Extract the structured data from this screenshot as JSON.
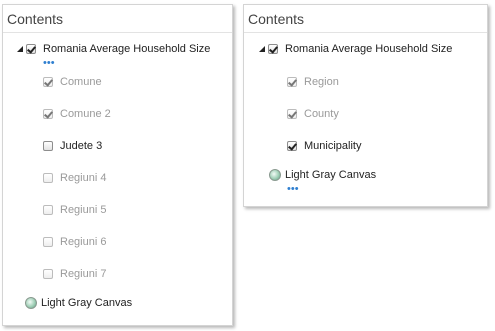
{
  "panels": [
    {
      "title": "Contents",
      "layer": {
        "label": "Romania Average Household Size",
        "checked": true,
        "more": "•••"
      },
      "sublayers": [
        {
          "label": "Comune",
          "checked": true
        },
        {
          "label": "Comune 2",
          "checked": true
        },
        {
          "label": "Judete 3",
          "checked": false
        },
        {
          "label": "Regiuni 4",
          "checked": false
        },
        {
          "label": "Regiuni 5",
          "checked": false
        },
        {
          "label": "Regiuni 6",
          "checked": false
        },
        {
          "label": "Regiuni 7",
          "checked": false
        }
      ],
      "basemap": {
        "label": "Light Gray Canvas",
        "icon": "basemap-icon"
      }
    },
    {
      "title": "Contents",
      "layer": {
        "label": "Romania Average Household Size",
        "checked": true
      },
      "sublayers": [
        {
          "label": "Region",
          "checked": true
        },
        {
          "label": "County",
          "checked": true
        },
        {
          "label": "Municipality",
          "checked": true
        }
      ],
      "basemap": {
        "label": "Light Gray Canvas",
        "icon": "basemap-icon",
        "more": "•••"
      }
    }
  ]
}
